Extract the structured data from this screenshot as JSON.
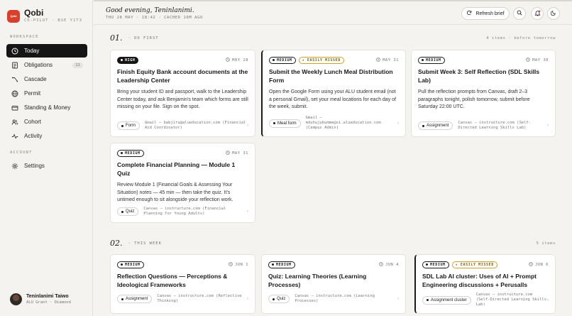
{
  "app": {
    "name": "Qobi",
    "subtitle": "CO-PILOT · BSE Y1T3",
    "logo_text": "Qobi"
  },
  "sidebar": {
    "workspace_label": "WORKSPACE",
    "items": [
      {
        "label": "Today",
        "icon": "clock-icon",
        "active": true
      },
      {
        "label": "Obligations",
        "icon": "list-icon",
        "count": "11"
      },
      {
        "label": "Cascade",
        "icon": "cascade-icon"
      },
      {
        "label": "Permit",
        "icon": "globe-icon"
      },
      {
        "label": "Standing & Money",
        "icon": "wallet-icon"
      },
      {
        "label": "Cohort",
        "icon": "people-icon"
      },
      {
        "label": "Activity",
        "icon": "activity-icon"
      }
    ],
    "account_label": "ACCOUNT",
    "settings_label": "Settings",
    "user": {
      "name": "Teninlanimi Taiwo",
      "subtitle": "ALU Grant · Diamond"
    }
  },
  "header": {
    "greeting": "Good evening, Teninlanimi.",
    "meta": "THU 28 MAY · 18:42 · CACHED 10M AGO",
    "refresh_label": "Refresh brief"
  },
  "sections": [
    {
      "number": "01.",
      "label": "· DO FIRST",
      "right": "4 items · before tomorrow"
    },
    {
      "number": "02.",
      "label": "· THIS WEEK",
      "right": "5 items"
    }
  ],
  "cards": [
    {
      "priority": "HIGH",
      "missed": "",
      "date": "MAY 28",
      "title": "Finish Equity Bank account documents at the Leadership Center",
      "desc": "Bring your student ID and passport, walk to the Leadership Center today, and ask Benjamin's team which forms are still missing on your file. Sign on the spot.",
      "type": "Form",
      "source": "Gmail — babjiru@alueducation.com (Financial Aid Coordinator)"
    },
    {
      "priority": "MEDIUM",
      "missed": "EASILY MISSED",
      "date": "MAY 31",
      "title": "Submit the Weekly Lunch Meal Distribution Form",
      "desc": "Open the Google Form using your ALU student email (not a personal Gmail), set your meal locations for each day of the week, submit.",
      "type": "Meal form",
      "source": "Gmail — mduhujubumme@si.alueducation.com (Campus Admin)"
    },
    {
      "priority": "MEDIUM",
      "missed": "",
      "date": "MAY 30",
      "title": "Submit Week 3: Self Reflection (SDL Skills Lab)",
      "desc": "Pull the reflection prompts from Canvas, draft 2–3 paragraphs tonight, polish tomorrow, submit before Saturday 22:00 UTC.",
      "type": "Assignment",
      "source": "Canvas — instructure.com (Self-Directed Learning Skills Lab)"
    },
    {
      "priority": "MEDIUM",
      "missed": "",
      "date": "MAY 31",
      "title": "Complete Financial Planning — Module 1 Quiz",
      "desc": "Review Module 1 (Financial Goals & Assessing Your Situation) notes — 45 min — then take the quiz. It's untimed enough to sit alongside your reflection work.",
      "type": "Quiz",
      "source": "Canvas — instructure.com (Financial Planning for Young Adults)"
    },
    {
      "priority": "MEDIUM",
      "missed": "",
      "date": "JUN 1",
      "title": "Reflection Questions — Perceptions & Ideological Frameworks",
      "desc": "",
      "type": "Assignment",
      "source": "Canvas — instructure.com (Reflective Thinking)"
    },
    {
      "priority": "MEDIUM",
      "missed": "",
      "date": "JUN 4",
      "title": "Quiz: Learning Theories (Learning Processes)",
      "desc": "",
      "type": "Quiz",
      "source": "Canvas — instructure.com (Learning Processes)"
    },
    {
      "priority": "MEDIUM",
      "missed": "EASILY MISSED",
      "date": "JUN 6",
      "title": "SDL Lab AI cluster: Uses of AI + Prompt Engineering discussions + Perusalls",
      "desc": "",
      "type": "Assignment cluster",
      "source": "Canvas — instructure.com (Self-Directed Learning Skills Lab)"
    }
  ]
}
